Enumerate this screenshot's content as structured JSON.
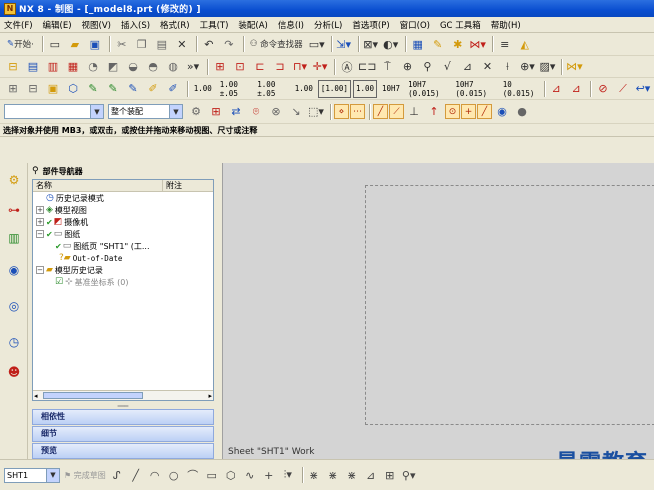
{
  "window": {
    "title": "NX 8 - 制图 - [_model8.prt  (修改的) ]",
    "app_icon": "nx-app-icon"
  },
  "menu": [
    "文件(F)",
    "编辑(E)",
    "视图(V)",
    "插入(S)",
    "格式(R)",
    "工具(T)",
    "装配(A)",
    "信息(I)",
    "分析(L)",
    "首选项(P)",
    "窗口(O)",
    "GC 工具箱",
    "帮助(H)"
  ],
  "toolbar1": {
    "start_label": "开始·",
    "command_finder_label": "命令查找器"
  },
  "toolbar3": {
    "dimension_labels": [
      "1.00",
      "1.00\n±.05",
      "1.00\n±.05",
      "1.00",
      "[1.00]",
      "1.00",
      "10H7",
      "10H7\n(0.015)",
      "10H7\n(0.015)",
      "10\n(0.015)"
    ]
  },
  "selection_bar": {
    "filter_value": "",
    "scope_value": "整个装配"
  },
  "cue_line": "选择对象并使用 MB3，或双击，或按住并拖动来移动视图、尺寸或注释",
  "navigator": {
    "title": "部件导航器",
    "col_name": "名称",
    "col_attach": "附注",
    "rows": [
      {
        "label": "历史记录模式",
        "indent": 0
      },
      {
        "label": "模型视图",
        "indent": 0
      },
      {
        "label": "摄像机",
        "indent": 0
      },
      {
        "label": "图纸",
        "indent": 0
      },
      {
        "label": "图纸页 \"SHT1\"  (工...",
        "indent": 1
      },
      {
        "label": "Out-of-Date",
        "indent": 2
      },
      {
        "label": "模型历史记录",
        "indent": 0
      },
      {
        "label": "基准坐标系 (0)",
        "indent": 1
      }
    ],
    "panels": [
      "相依性",
      "细节",
      "预览"
    ]
  },
  "graphics": {
    "sheet_label": "Sheet \"SHT1\" Work",
    "watermark": "最需教育"
  },
  "bottom_bar": {
    "sheet_select": "SHT1",
    "finish_sketch": "完成草图"
  },
  "colors": {
    "title_bar": "#0a4ed0",
    "panel_button": "#bcd0f5",
    "watermark": "#1a4fa0",
    "graphics_bg": "#d4d4d4"
  }
}
